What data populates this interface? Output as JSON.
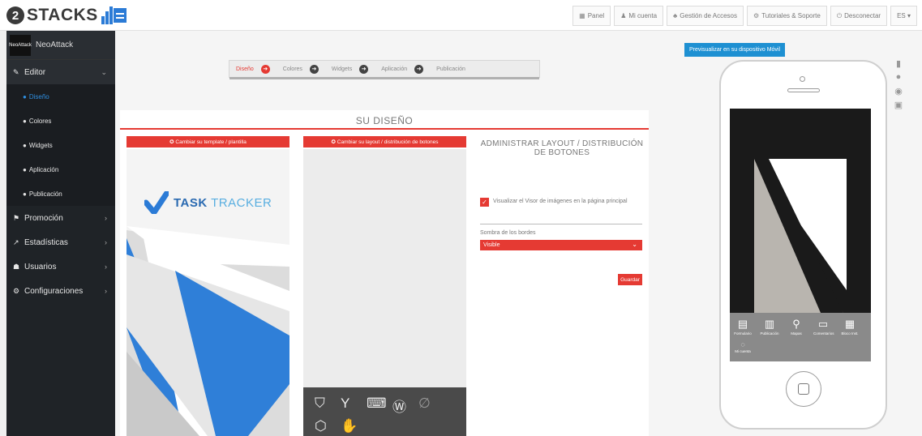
{
  "brand": {
    "badge": "2",
    "name": "STACKS"
  },
  "topnav": [
    {
      "icon": "▦",
      "label": "Panel"
    },
    {
      "icon": "♟",
      "label": "Mi cuenta"
    },
    {
      "icon": "♣",
      "label": "Gestión de Accesos"
    },
    {
      "icon": "⚙",
      "label": "Tutoriales & Soporte"
    },
    {
      "icon": "⏻",
      "label": "Desconectar"
    },
    {
      "icon": "",
      "label": "ES ▾"
    }
  ],
  "sidebar": {
    "account_name": "NeoAttack",
    "avatar_text": "NeoAttack",
    "items": [
      {
        "icon": "✎",
        "label": "Editor",
        "chevron": "⌄"
      },
      {
        "icon": "⚑",
        "label": "Promoción",
        "chevron": "›"
      },
      {
        "icon": "↗",
        "label": "Estadísticas",
        "chevron": "›"
      },
      {
        "icon": "☗",
        "label": "Usuarios",
        "chevron": "›"
      },
      {
        "icon": "⚙",
        "label": "Configuraciones",
        "chevron": "›"
      }
    ],
    "subitems": [
      {
        "label": "Diseño"
      },
      {
        "label": "Colores"
      },
      {
        "label": "Widgets"
      },
      {
        "label": "Aplicación"
      },
      {
        "label": "Publicación"
      }
    ]
  },
  "steps": [
    {
      "label": "Diseño",
      "arrow": "➜"
    },
    {
      "label": "Colores",
      "arrow": "➜"
    },
    {
      "label": "Widgets",
      "arrow": "➜"
    },
    {
      "label": "Aplicación",
      "arrow": "➜"
    },
    {
      "label": "Publicación",
      "arrow": ""
    }
  ],
  "editor": {
    "title": "SU DISEÑO",
    "template_button": "✪ Cambiar su template / plantilla",
    "layout_button": "✪ Cambiar su layout / distribución de botones",
    "admin_title": "ADMINISTRAR LAYOUT / DISTRIBUCIÓN DE BOTONES",
    "checkbox_label": "Visualizar el Visor de imágenes en la página principal",
    "checkbox_checked": true,
    "select_label": "Sombra de los bordes",
    "select_value": "Visible",
    "save_label": "Guardar"
  },
  "template_preview": {
    "logo_text_bold": "TASK",
    "logo_text_light": "TRACKER"
  },
  "preview": {
    "button_label": "Previsualizar en su dispositivo Móvil",
    "menu_items": [
      "Formulario",
      "Publicación",
      "Mapas",
      "Comentarios",
      "Bloco Inst."
    ],
    "extra_item": "Mi cuenta"
  },
  "os_icons": [
    "android-icon",
    "apple-icon",
    "android-robot-icon",
    "html5-icon"
  ],
  "colors": {
    "accent_red": "#e53a33",
    "preview_blue": "#1e90d2",
    "sidebar_bg": "#1f2327",
    "brand_blue": "#2b7bd6"
  }
}
